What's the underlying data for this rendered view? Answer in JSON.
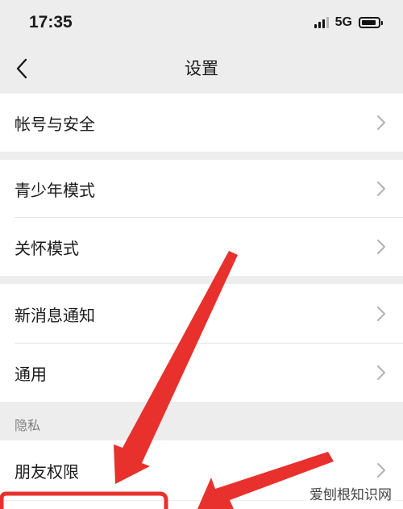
{
  "status": {
    "time": "17:35",
    "network": "5G"
  },
  "nav": {
    "title": "设置",
    "back_icon": "chevron-left-icon"
  },
  "rows": [
    {
      "label": "帐号与安全"
    },
    {
      "label": "青少年模式"
    },
    {
      "label": "关怀模式"
    },
    {
      "label": "新消息通知"
    },
    {
      "label": "通用"
    },
    {
      "label": "朋友权限"
    }
  ],
  "sections": {
    "privacy": "隐私"
  },
  "colors": {
    "background": "#ededed",
    "row": "#ffffff",
    "annotation_arrow": "#e8312c"
  },
  "watermark": {
    "text": "爱刨根知识网"
  }
}
